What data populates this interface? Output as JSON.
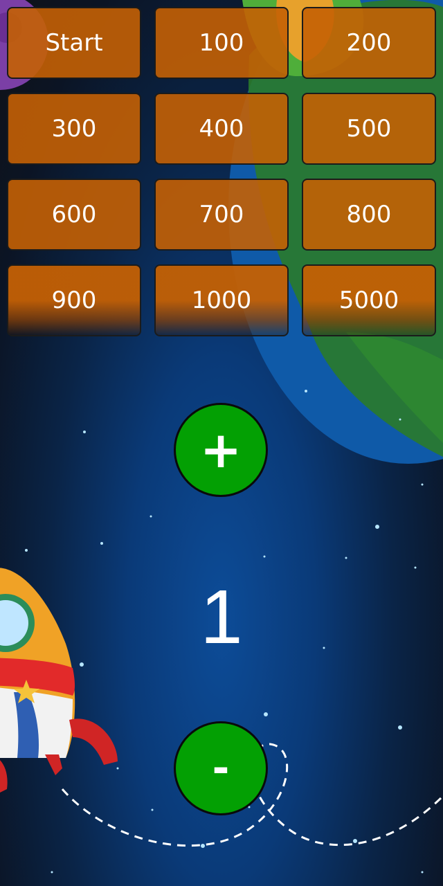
{
  "levels": [
    {
      "label": "Start"
    },
    {
      "label": "100"
    },
    {
      "label": "200"
    },
    {
      "label": "300"
    },
    {
      "label": "400"
    },
    {
      "label": "500"
    },
    {
      "label": "600"
    },
    {
      "label": "700"
    },
    {
      "label": "800"
    },
    {
      "label": "900"
    },
    {
      "label": "1000"
    },
    {
      "label": "5000"
    }
  ],
  "controls": {
    "increment_label": "+",
    "decrement_label": "-"
  },
  "counter": {
    "value": "1"
  },
  "colors": {
    "button_orange": "#c46004",
    "round_green": "#03a003",
    "space_blue": "#0a3a78"
  }
}
